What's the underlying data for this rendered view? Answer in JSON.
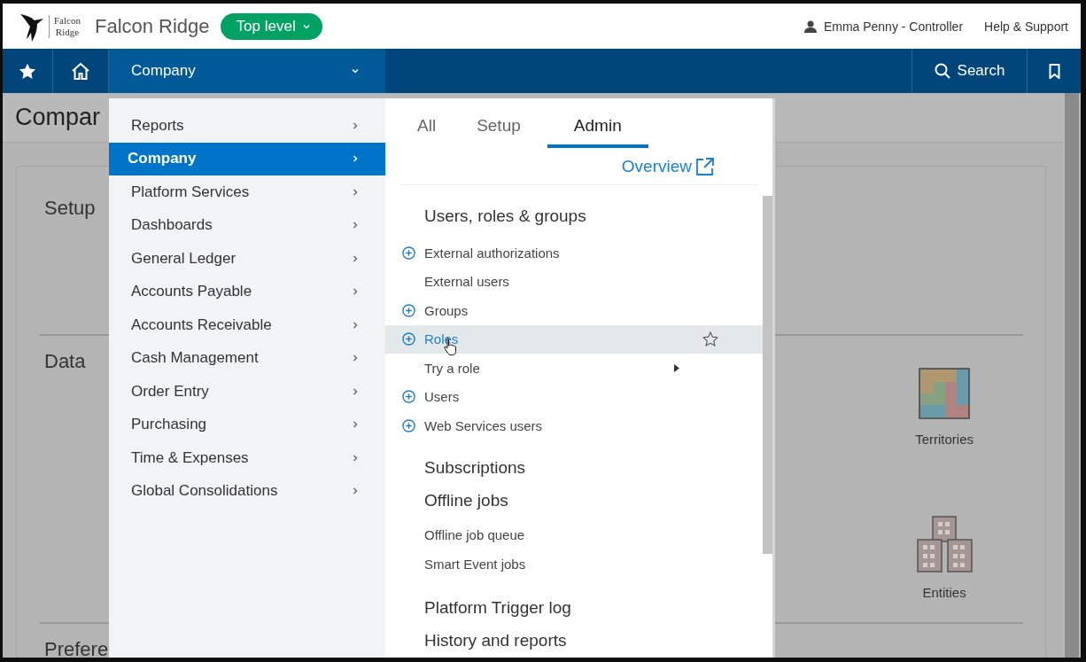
{
  "header": {
    "logo_lines": [
      "Falcon",
      "Ridge"
    ],
    "company": "Falcon Ridge",
    "level_button": "Top level",
    "user": "Emma Penny - Controller",
    "help": "Help & Support"
  },
  "navbar": {
    "module": "Company",
    "search": "Search"
  },
  "page": {
    "title": "Compar",
    "sections": [
      "Setup",
      "Data",
      "Prefere"
    ],
    "tiles": [
      {
        "label": "Territories",
        "kind": "territories"
      },
      {
        "label": "Entities",
        "kind": "entities"
      }
    ]
  },
  "menu": {
    "modules": [
      {
        "label": "Reports",
        "selected": false
      },
      {
        "label": "Company",
        "selected": true
      },
      {
        "label": "Platform Services",
        "selected": false
      },
      {
        "label": "Dashboards",
        "selected": false
      },
      {
        "label": "General Ledger",
        "selected": false
      },
      {
        "label": "Accounts Payable",
        "selected": false
      },
      {
        "label": "Accounts Receivable",
        "selected": false
      },
      {
        "label": "Cash Management",
        "selected": false
      },
      {
        "label": "Order Entry",
        "selected": false
      },
      {
        "label": "Purchasing",
        "selected": false
      },
      {
        "label": "Time & Expenses",
        "selected": false
      },
      {
        "label": "Global Consolidations",
        "selected": false
      }
    ],
    "tabs": [
      {
        "label": "All",
        "selected": false
      },
      {
        "label": "Setup",
        "selected": false
      },
      {
        "label": "Admin",
        "selected": true
      }
    ],
    "overview_link": "Overview",
    "groups": [
      {
        "heading": "Users, roles & groups",
        "items": [
          {
            "label": "External authorizations",
            "addable": true,
            "submenu": false,
            "highlighted": false
          },
          {
            "label": "External users",
            "addable": false,
            "submenu": false,
            "highlighted": false
          },
          {
            "label": "Groups",
            "addable": true,
            "submenu": false,
            "highlighted": false
          },
          {
            "label": "Roles",
            "addable": true,
            "submenu": false,
            "highlighted": true
          },
          {
            "label": "Try a role",
            "addable": false,
            "submenu": true,
            "highlighted": false
          },
          {
            "label": "Users",
            "addable": true,
            "submenu": false,
            "highlighted": false
          },
          {
            "label": "Web Services users",
            "addable": true,
            "submenu": false,
            "highlighted": false
          }
        ]
      },
      {
        "heading": "Subscriptions"
      },
      {
        "heading": "Offline jobs",
        "items": [
          {
            "label": "Offline job queue",
            "addable": false,
            "submenu": false,
            "highlighted": false
          },
          {
            "label": "Smart Event jobs",
            "addable": false,
            "submenu": false,
            "highlighted": false
          }
        ]
      },
      {
        "heading": "Platform Trigger log"
      },
      {
        "heading": "History and reports"
      }
    ]
  }
}
